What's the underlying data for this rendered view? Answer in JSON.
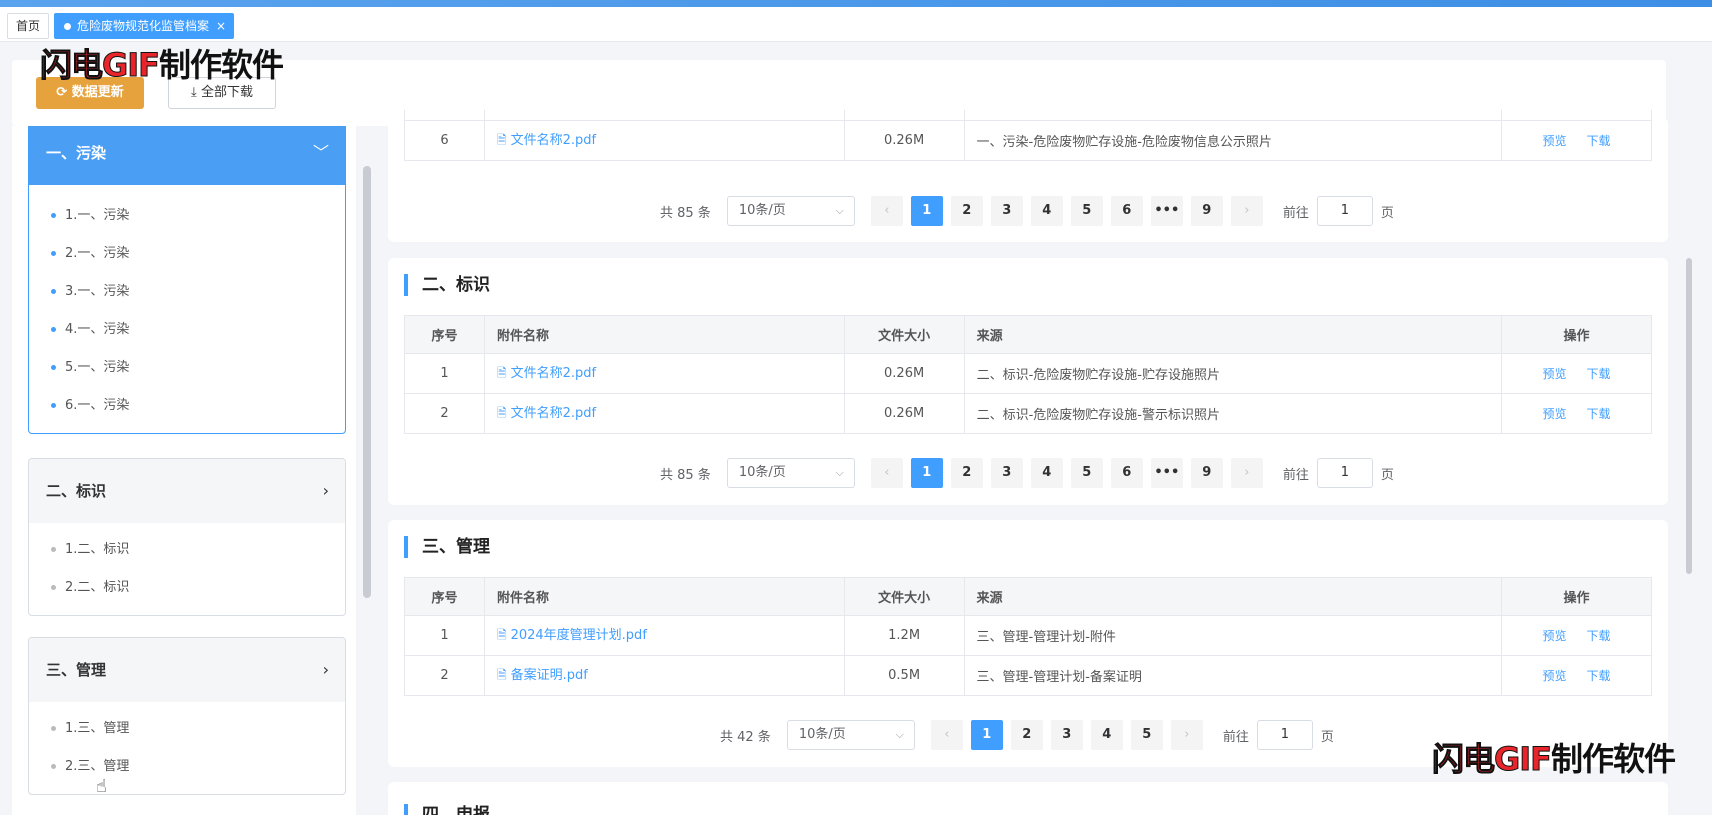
{
  "tabs": {
    "home": "首页",
    "active": "危险废物规范化监管档案",
    "close": "×"
  },
  "watermark": {
    "red": "闪电GIF",
    "black": "制作软件"
  },
  "toolbar": {
    "refresh_label": "数据更新",
    "refresh_icon": "⟳",
    "download_label": "全部下载",
    "download_icon": "⤓"
  },
  "sidebar": {
    "groups": [
      {
        "title": "一、污染",
        "chevron": "﹀",
        "items": [
          "1.一、污染",
          "2.一、污染",
          "3.一、污染",
          "4.一、污染",
          "5.一、污染",
          "6.一、污染"
        ]
      },
      {
        "title": "二、标识",
        "chevron": "›",
        "items": [
          "1.二、标识",
          "2.二、标识"
        ]
      },
      {
        "title": "三、管理",
        "chevron": "›",
        "items": [
          "1.三、管理",
          "2.三、管理"
        ]
      }
    ]
  },
  "table_headers": {
    "no": "序号",
    "name": "附件名称",
    "size": "文件大小",
    "source": "来源",
    "op": "操作"
  },
  "ops": {
    "preview": "预览",
    "download": "下载"
  },
  "doc_icon": "🗎",
  "sections": {
    "s1": {
      "rows": [
        {
          "no": "6",
          "name": "文件名称2.pdf",
          "size": "0.26M",
          "source": "一、污染-危险废物贮存设施-危险废物信息公示照片"
        }
      ],
      "pager": {
        "total": "共 85 条",
        "page_size": "10条/页",
        "pages": [
          "1",
          "2",
          "3",
          "4",
          "5",
          "6",
          "•••",
          "9"
        ],
        "goto": "前往",
        "jump_value": "1",
        "unit": "页"
      }
    },
    "s2": {
      "title": "二、标识",
      "rows": [
        {
          "no": "1",
          "name": "文件名称2.pdf",
          "size": "0.26M",
          "source": "二、标识-危险废物贮存设施-贮存设施照片"
        },
        {
          "no": "2",
          "name": "文件名称2.pdf",
          "size": "0.26M",
          "source": "二、标识-危险废物贮存设施-警示标识照片"
        }
      ],
      "pager": {
        "total": "共 85 条",
        "page_size": "10条/页",
        "pages": [
          "1",
          "2",
          "3",
          "4",
          "5",
          "6",
          "•••",
          "9"
        ],
        "goto": "前往",
        "jump_value": "1",
        "unit": "页"
      }
    },
    "s3": {
      "title": "三、管理",
      "rows": [
        {
          "no": "1",
          "name": "2024年度管理计划.pdf",
          "size": "1.2M",
          "source": "三、管理-管理计划-附件"
        },
        {
          "no": "2",
          "name": "备案证明.pdf",
          "size": "0.5M",
          "source": "三、管理-管理计划-备案证明"
        }
      ],
      "pager": {
        "total": "共 42 条",
        "page_size": "10条/页",
        "pages": [
          "1",
          "2",
          "3",
          "4",
          "5"
        ],
        "goto": "前往",
        "jump_value": "1",
        "unit": "页"
      }
    },
    "s4": {
      "title": "四、申报"
    }
  },
  "pager_nav": {
    "prev": "‹",
    "next": "›",
    "arrow": "⌵"
  }
}
